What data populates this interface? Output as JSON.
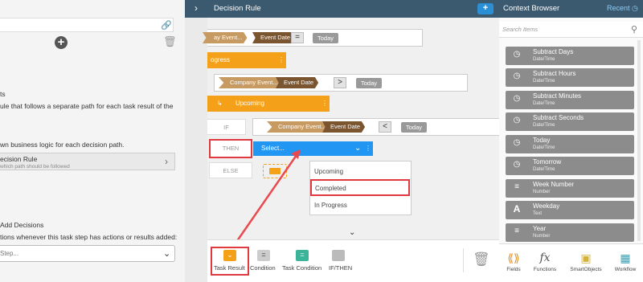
{
  "left": {
    "text_ts": "ts",
    "text_rule": "ule that follows a separate path for each task result of the",
    "text_logic": "wn business logic for each decision path.",
    "decision_rule": {
      "title": "ecision Rule",
      "subtitle": "which path should be followed"
    },
    "add_decisions": "Add Decisions",
    "add_decisions_desc": "tions whenever this task step has actions or results added:",
    "step_placeholder": "Step..."
  },
  "center": {
    "title": "Decision Rule",
    "row1": {
      "event_light": "ay Event...",
      "event_brown": "Event Date",
      "op": "=",
      "value": "Today"
    },
    "row2": {
      "label": "ogress"
    },
    "row3": {
      "event_light": "Company Event...",
      "event_brown": "Event Date",
      "op": ">",
      "value": "Today"
    },
    "row4": {
      "label": "Upcoming"
    },
    "row5": {
      "if": "IF",
      "event_light": "Company Event...",
      "event_brown": "Event Date",
      "op": "<",
      "value": "Today"
    },
    "then": "THEN",
    "else": "ELSE",
    "select": "Select...",
    "dropdown": [
      "Upcoming",
      "Completed",
      "In Progress"
    ],
    "toolbar": [
      {
        "label": "Task Result"
      },
      {
        "label": "Condition"
      },
      {
        "label": "Task Condition"
      },
      {
        "label": "IF/THEN"
      }
    ]
  },
  "right": {
    "title": "Context Browser",
    "recent": "Recent",
    "search_placeholder": "Search Items",
    "functions": [
      {
        "name": "Subtract Days",
        "type": "Date/Time",
        "icon": "calendar-icon"
      },
      {
        "name": "Subtract Hours",
        "type": "Date/Time",
        "icon": "calendar-icon"
      },
      {
        "name": "Subtract Minutes",
        "type": "Date/Time",
        "icon": "calendar-icon"
      },
      {
        "name": "Subtract Seconds",
        "type": "Date/Time",
        "icon": "calendar-icon"
      },
      {
        "name": "Today",
        "type": "Date/Time",
        "icon": "calendar-icon"
      },
      {
        "name": "Tomorrow",
        "type": "Date/Time",
        "icon": "calendar-icon"
      },
      {
        "name": "Week Number",
        "type": "Number",
        "icon": "list-number-icon"
      },
      {
        "name": "Weekday",
        "type": "Text",
        "icon": "text-a-icon"
      },
      {
        "name": "Year",
        "type": "Number",
        "icon": "list-number-icon"
      }
    ],
    "nav": [
      {
        "label": "Fields",
        "icon": "fields-icon"
      },
      {
        "label": "Functions",
        "icon": "functions-icon"
      },
      {
        "label": "SmartObjects",
        "icon": "smartobjects-icon"
      },
      {
        "label": "Workflow",
        "icon": "workflow-icon"
      }
    ]
  },
  "colors": {
    "header": "#3b5a70",
    "accent_blue": "#2196f3",
    "orange": "#f5a019",
    "highlight_red": "#e03a40"
  }
}
